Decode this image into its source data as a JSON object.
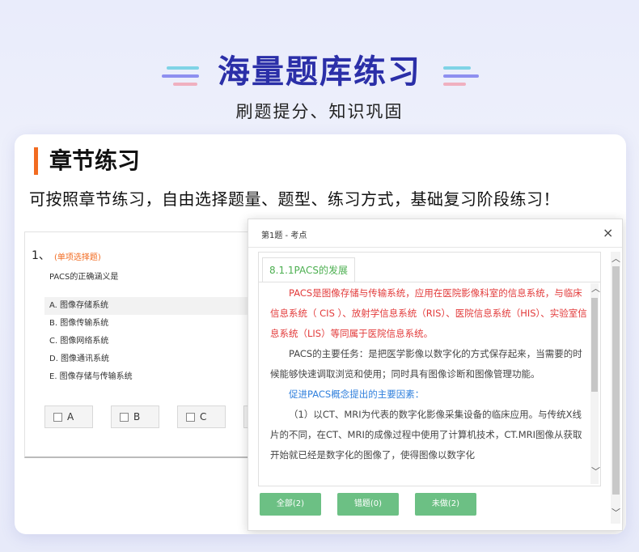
{
  "hero": {
    "title": "海量题库练习",
    "subtitle": "刷题提分、知识巩固"
  },
  "section": {
    "title": "章节练习",
    "description": "可按照章节练习，自由选择题量、题型、练习方式，基础复习阶段练习！"
  },
  "question": {
    "number": "1、",
    "type": "(单项选择题)",
    "stem": "PACS的正确涵义是",
    "options": [
      "A. 图像存储系统",
      "B. 图像传输系统",
      "C. 图像网络系统",
      "D. 图像通讯系统",
      "E. 图像存储与传输系统"
    ],
    "answers": [
      "A",
      "B",
      "C"
    ]
  },
  "modal": {
    "title": "第1题 - 考点",
    "close": "×",
    "knowledge_point": "8.1.1PACS的发展",
    "paragraphs": [
      "PACS是图像存储与传输系统，应用在医院影像科室的信息系统，与临床信息系统（ CIS ）、放射学信息系统（RIS）、医院信息系统（HIS）、实验室信息系统（LIS）等同属于医院信息系统。",
      "PACS的主要任务：是把医学影像以数字化的方式保存起来，当需要的时候能够快速调取浏览和使用；同时具有图像诊断和图像管理功能。",
      "促进PACS概念提出的主要因素：",
      "（1）以CT、MRI为代表的数字化影像采集设备的临床应用。与传统X线片的不同，在CT、MRI的成像过程中使用了计算机技术，CT.MRI图像从获取开始就已经是数字化的图像了，使得图像以数字化"
    ],
    "buttons": [
      "全部(2)",
      "错题(0)",
      "未做(2)"
    ]
  },
  "colors": {
    "accent_blue": "#2b2fa8",
    "orange": "#f26b21",
    "green": "#6cc084"
  }
}
